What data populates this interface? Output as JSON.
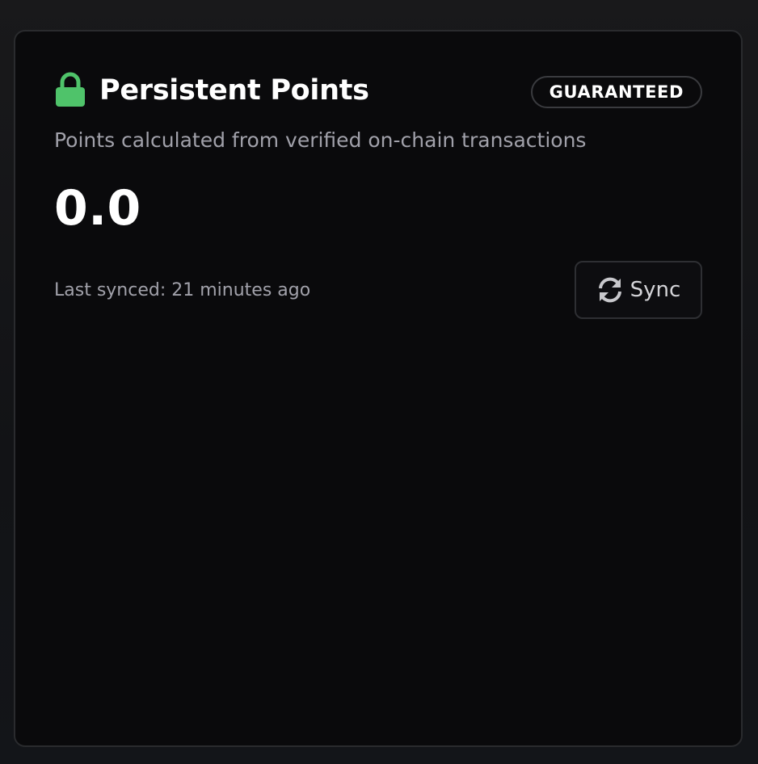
{
  "card": {
    "title": "Persistent Points",
    "title_icon": "lock-icon",
    "badge": "GUARANTEED",
    "subtitle": "Points calculated from verified on-chain transactions",
    "points_value": "0.0",
    "last_synced": "Last synced: 21 minutes ago",
    "sync_button": {
      "label": "Sync",
      "icon": "refresh-icon"
    }
  },
  "colors": {
    "accent_green": "#4fc36a",
    "card_background": "#0a0a0c",
    "border": "#2a2b2e",
    "muted_text": "#a1a1aa"
  }
}
